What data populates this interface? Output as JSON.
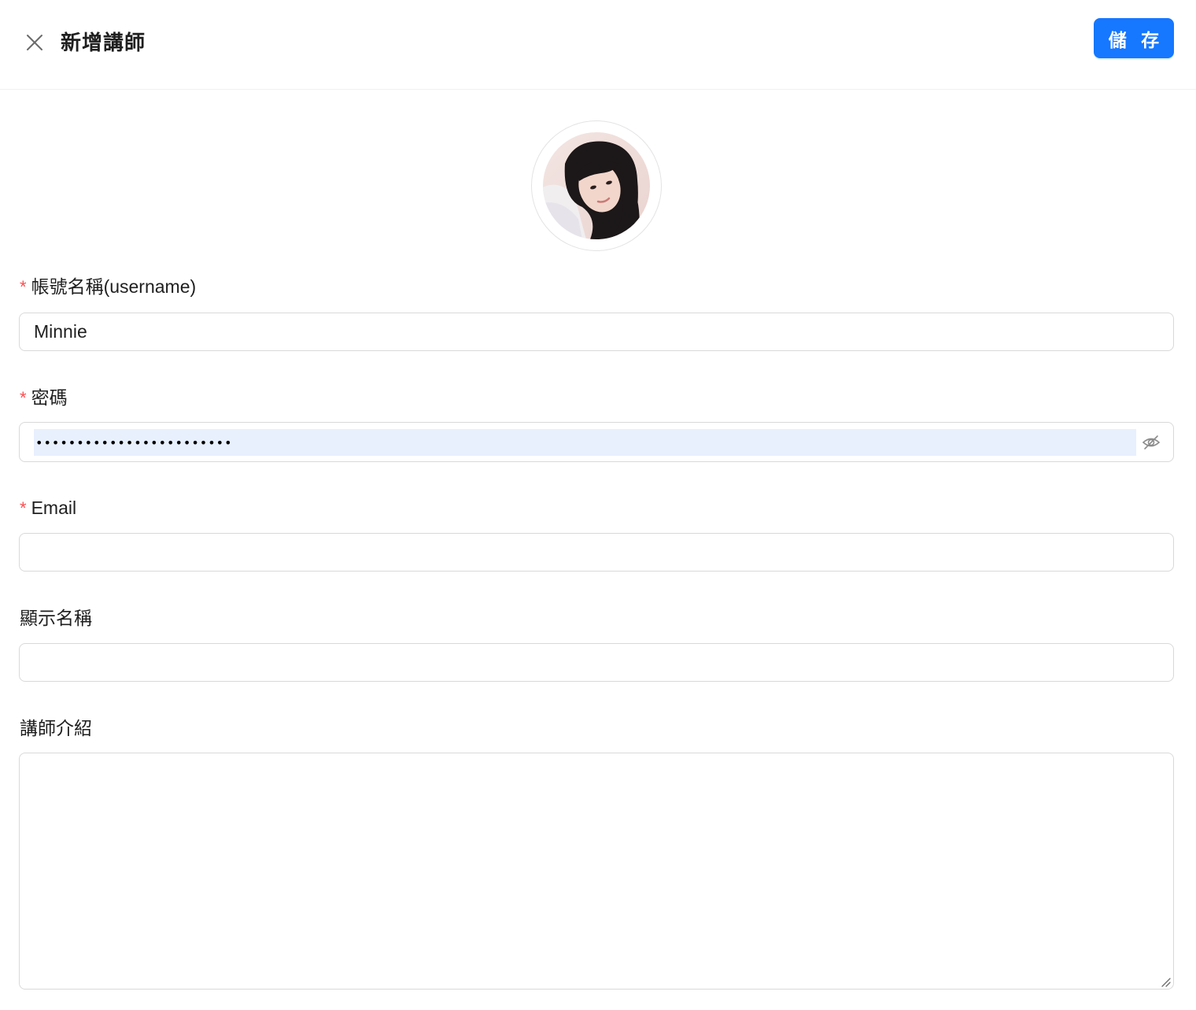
{
  "header": {
    "title": "新增講師",
    "save_label": "儲 存"
  },
  "form": {
    "username": {
      "required_mark": "*",
      "label": "帳號名稱(username)",
      "value": "Minnie"
    },
    "password": {
      "required_mark": "*",
      "label": "密碼",
      "masked_value": "••••••••••••••••••••••••"
    },
    "email": {
      "required_mark": "*",
      "label": "Email",
      "value": ""
    },
    "display_name": {
      "label": "顯示名稱",
      "value": ""
    },
    "bio": {
      "label": "講師介紹",
      "value": ""
    }
  },
  "colors": {
    "primary": "#1677ff",
    "required": "#ff4d4f",
    "border": "#d9d9d9",
    "autofill": "#e8f0fe"
  },
  "icons": {
    "close": "close-icon",
    "password_toggle": "eye-invisible-icon"
  }
}
